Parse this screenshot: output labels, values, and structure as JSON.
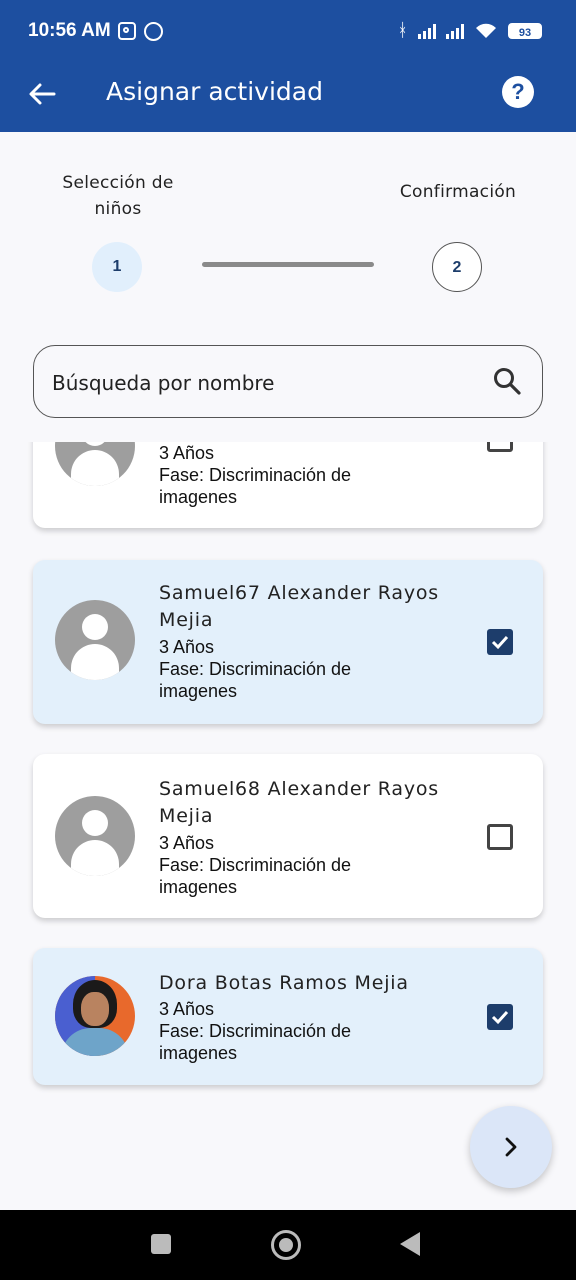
{
  "status_bar": {
    "time": "10:56 AM",
    "battery": "93"
  },
  "app_bar": {
    "title": "Asignar actividad",
    "help_label": "?"
  },
  "stepper": {
    "steps": [
      {
        "number": "1",
        "label_line1": "Selección de",
        "label_line2": "niños"
      },
      {
        "number": "2",
        "label_line1": "Confirmación",
        "label_line2": ""
      }
    ]
  },
  "search": {
    "placeholder": "Búsqueda por nombre",
    "value": ""
  },
  "children": [
    {
      "name_line1": "",
      "name_line2": "",
      "age": "3 Años",
      "phase_line1": "Fase: Discriminación de",
      "phase_line2": "imagenes",
      "selected": false,
      "avatar": "default-avatar-icon"
    },
    {
      "name_line1": "Samuel67 Alexander Rayos",
      "name_line2": "Mejia",
      "age": "3 Años",
      "phase_line1": "Fase: Discriminación de",
      "phase_line2": "imagenes",
      "selected": true,
      "avatar": "default-avatar-icon"
    },
    {
      "name_line1": "Samuel68 Alexander Rayos",
      "name_line2": "Mejia",
      "age": "3 Años",
      "phase_line1": "Fase: Discriminación de",
      "phase_line2": "imagenes",
      "selected": false,
      "avatar": "default-avatar-icon"
    },
    {
      "name_line1": "Dora Botas Ramos Mejia",
      "name_line2": "",
      "age": "3 Años",
      "phase_line1": "Fase: Discriminación de",
      "phase_line2": "imagenes",
      "selected": true,
      "avatar": "photo"
    }
  ],
  "colors": {
    "primary": "#1d4fa0",
    "selected_card": "#e3f0fb",
    "checkbox": "#1d3d6b"
  }
}
